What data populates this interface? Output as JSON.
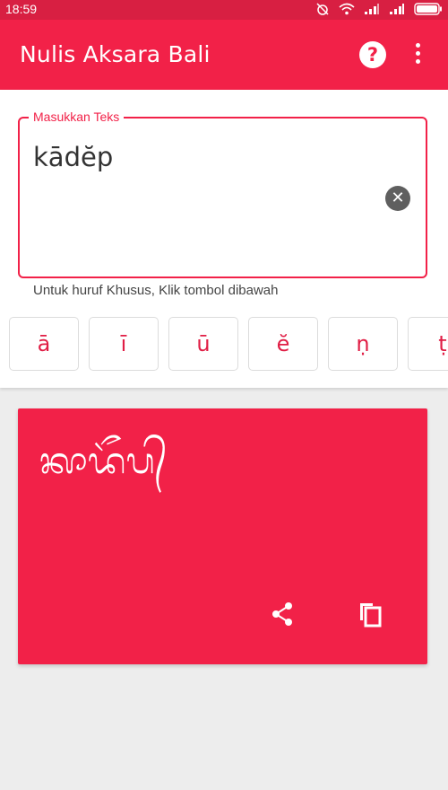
{
  "status_bar": {
    "time": "18:59"
  },
  "app_bar": {
    "title": "Nulis Aksara Bali",
    "help_icon": "help-circle-icon",
    "more_icon": "more-vert-icon"
  },
  "input": {
    "label": "Masukkan Teks",
    "value": "kādĕp",
    "helper_text": "Untuk huruf Khusus, Klik tombol dibawah"
  },
  "special_chars": [
    "ā",
    "ī",
    "ū",
    "ĕ",
    "ṇ",
    "ṭ"
  ],
  "output": {
    "script_text": "ᬓᬵᬤᭂᬧ᭄"
  },
  "colors": {
    "primary": "#f22148",
    "status_bar": "#d81f42",
    "background": "#ededed"
  }
}
